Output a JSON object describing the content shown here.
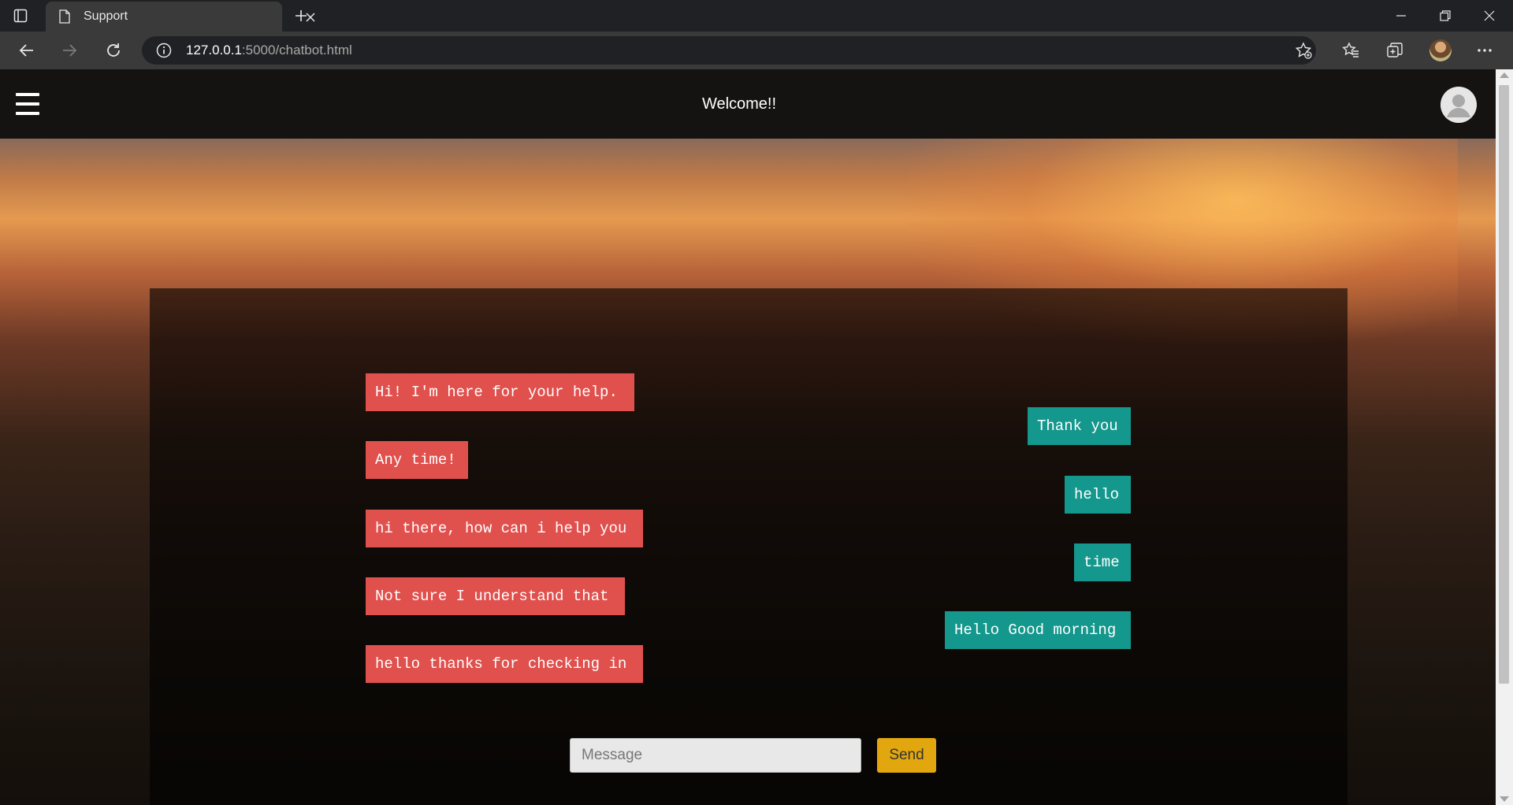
{
  "browser": {
    "tab_title": "Support",
    "url_host": "127.0.0.1",
    "url_rest": ":5000/chatbot.html"
  },
  "navbar": {
    "title": "Welcome!!"
  },
  "chat": {
    "bot_messages": [
      "Hi! I'm here for your help.",
      "Any time!",
      "hi there, how can i help you",
      "Not sure I understand that",
      "hello thanks for checking in"
    ],
    "user_messages": [
      "Thank you",
      "hello",
      "time",
      "Hello Good morning"
    ],
    "input_placeholder": "Message",
    "send_label": "Send"
  },
  "colors": {
    "bot_bubble": "#e0504d",
    "user_bubble": "#14978c",
    "send_button": "#e2a70e"
  }
}
